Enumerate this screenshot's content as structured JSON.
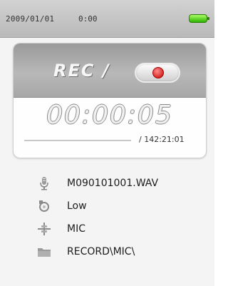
{
  "status_bar": {
    "date": "2009/01/01",
    "time": "0:00",
    "battery_level": 1.0,
    "battery_color": "#33cc00"
  },
  "recorder": {
    "mode_label": "REC /",
    "record_button_icon": "record-dot-icon",
    "record_button_color": "#cc0000",
    "elapsed_time": "00:00:05",
    "total_time": "/ 142:21:01",
    "progress_fraction": 0.0
  },
  "info": [
    {
      "icon": "microphone-icon",
      "text": "M090101001.WAV"
    },
    {
      "icon": "quality-icon",
      "text": "Low"
    },
    {
      "icon": "input-source-icon",
      "text": "MIC"
    },
    {
      "icon": "folder-icon",
      "text": "RECORD\\MIC\\"
    }
  ]
}
